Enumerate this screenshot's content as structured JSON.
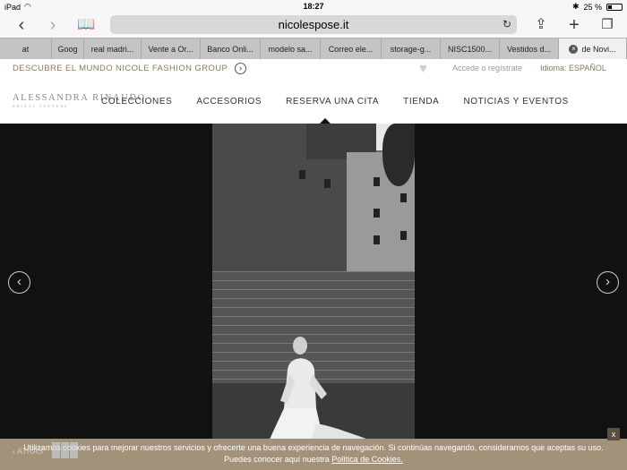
{
  "status": {
    "device": "iPad",
    "time": "18:27",
    "battery": "25 %",
    "battery_level": 0.25
  },
  "browser": {
    "url": "nicolespose.it",
    "back_icon": "chevron-left-icon",
    "forward_icon": "chevron-right-icon",
    "bookmarks_icon": "book-icon",
    "reload_icon": "reload-icon",
    "share_icon": "share-icon",
    "add_icon": "plus-icon",
    "tabs_icon": "tabs-icon",
    "tabs": [
      {
        "label": "at"
      },
      {
        "label": "Goog"
      },
      {
        "label": "real madri..."
      },
      {
        "label": "Vente a Or..."
      },
      {
        "label": "Banco Onli..."
      },
      {
        "label": "modelo sa..."
      },
      {
        "label": "Correo ele..."
      },
      {
        "label": "storage-g..."
      },
      {
        "label": "NISC1500..."
      },
      {
        "label": "Vestidos d..."
      },
      {
        "label": "de Novi..."
      }
    ]
  },
  "site": {
    "discover": "DESCUBRE EL MUNDO NICOLE FASHION GROUP",
    "login": "Accede o regístrate",
    "language_label": "Idioma:",
    "language_value": "ESPAÑOL",
    "logo": "ALESSANDRA RINAUDO",
    "logo_sub": "BRIDAL COUTURE",
    "nav": [
      {
        "label": "COLECCIONES"
      },
      {
        "label": "ACCESORIOS"
      },
      {
        "label": "RESERVA UNA CITA"
      },
      {
        "label": "TIENDA"
      },
      {
        "label": "NOTICIAS Y EVENTOS"
      }
    ]
  },
  "cookie": {
    "line1": "Utilizamos cookies para mejorar nuestros servicios y ofrecerte una buena experiencia de navegación. Si continúas navegando, consideramos que aceptas su uso.",
    "line2_prefix": "Puedes conocer aquí nuestra ",
    "link": "Política de Cookies.",
    "close": "x",
    "back": "ATRÁS"
  }
}
